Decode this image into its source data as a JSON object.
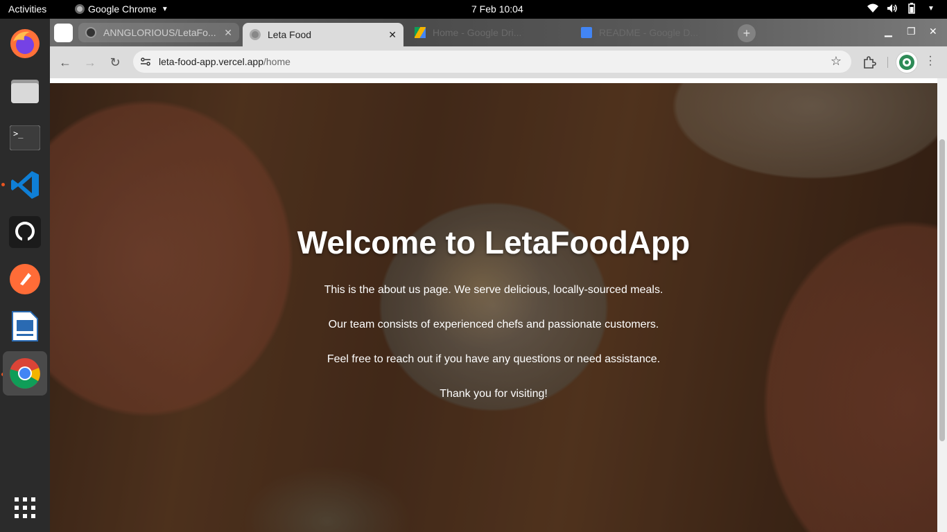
{
  "system_bar": {
    "activities": "Activities",
    "app_name": "Google Chrome",
    "clock": "7 Feb  10:04"
  },
  "dock": {
    "items": [
      "firefox",
      "files",
      "terminal",
      "vscode",
      "github-desktop",
      "postman",
      "libreoffice-impress",
      "chrome",
      "app-grid"
    ]
  },
  "browser": {
    "tabs": [
      {
        "title": "ANNGLORIOUS/LetaFo..."
      },
      {
        "title": "Leta Food"
      },
      {
        "title": "Home - Google Dri..."
      },
      {
        "title": "README - Google D..."
      }
    ],
    "address": {
      "host": "leta-food-app.vercel.app",
      "path": "/home"
    }
  },
  "page": {
    "heading": "Welcome to LetaFoodApp",
    "paragraphs": [
      "This is the about us page. We serve delicious, locally-sourced meals.",
      "Our team consists of experienced chefs and passionate customers.",
      "Feel free to reach out if you have any questions or need assistance.",
      "Thank you for visiting!"
    ]
  }
}
